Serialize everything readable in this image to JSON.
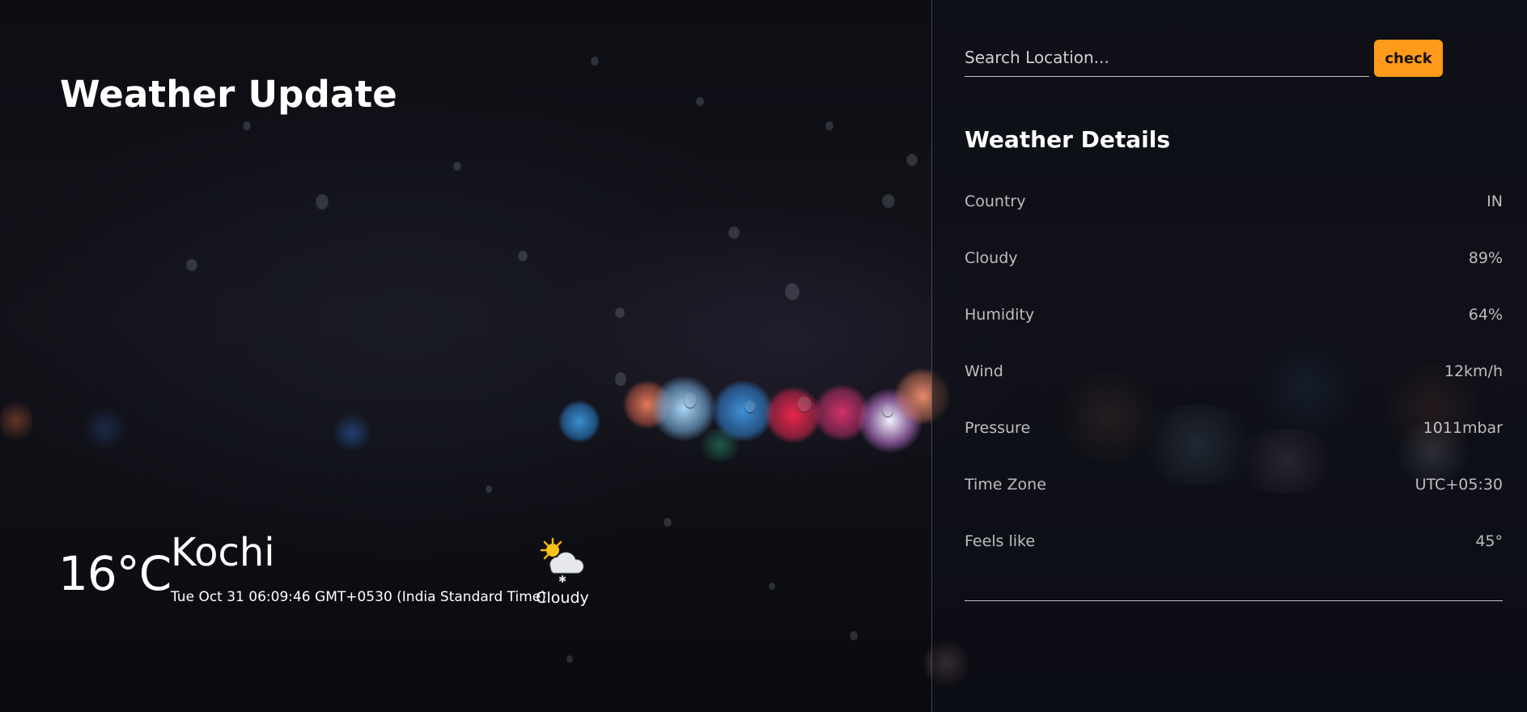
{
  "app": {
    "title": "Weather Update"
  },
  "current": {
    "temperature": "16°C",
    "city": "Kochi",
    "datetime": "Tue Oct 31 06:09:46 GMT+0530 (India Standard Time)",
    "condition": "Cloudy",
    "condition_icon": "partly-cloudy-snow-icon"
  },
  "search": {
    "placeholder": "Search Location...",
    "value": "",
    "button_label": "check"
  },
  "details": {
    "title": "Weather Details",
    "rows": [
      {
        "label": "Country",
        "value": "IN"
      },
      {
        "label": "Cloudy",
        "value": "89%"
      },
      {
        "label": "Humidity",
        "value": "64%"
      },
      {
        "label": "Wind",
        "value": "12km/h"
      },
      {
        "label": "Pressure",
        "value": "1011mbar"
      },
      {
        "label": "Time Zone",
        "value": "UTC+05:30"
      },
      {
        "label": "Feels like",
        "value": "45°"
      }
    ]
  },
  "colors": {
    "accent": "#ff9a1a",
    "text": "#ffffff",
    "panel": "#0e1018"
  }
}
